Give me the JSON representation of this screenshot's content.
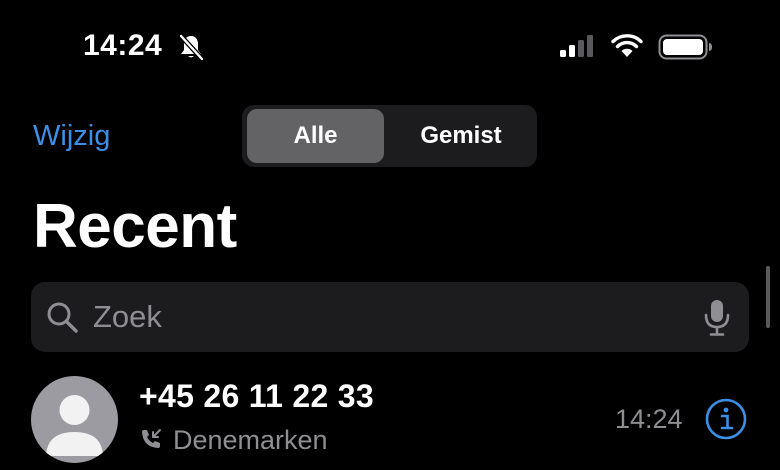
{
  "status_bar": {
    "time": "14:24",
    "icons": [
      "bell-slash-icon",
      "signal-icon",
      "wifi-icon",
      "battery-icon"
    ]
  },
  "header": {
    "edit_label": "Wijzig",
    "segments": [
      {
        "label": "Alle",
        "selected": true
      },
      {
        "label": "Gemist",
        "selected": false
      }
    ],
    "title": "Recent"
  },
  "search": {
    "placeholder": "Zoek",
    "icons": [
      "search-icon",
      "mic-icon"
    ]
  },
  "calls": [
    {
      "name": "+45 26 11 22 33",
      "subtitle": "Denemarken",
      "time": "14:24",
      "call_icon": "phone-incoming-icon",
      "action_icon": "info-icon"
    }
  ],
  "colors": {
    "background": "#000000",
    "accent": "#3b8fe6",
    "secondary_text": "#8e8e93",
    "search_bg": "#1c1c1e",
    "segment_selected": "#636366"
  }
}
